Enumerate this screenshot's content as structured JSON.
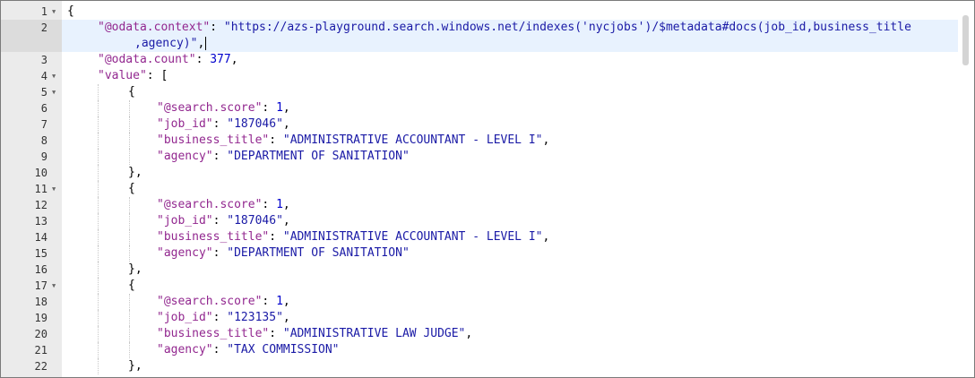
{
  "gutter": {
    "lines": [
      {
        "n": "1",
        "fold": true
      },
      {
        "n": "2",
        "fold": false,
        "active": true
      },
      {
        "n": "3",
        "fold": false
      },
      {
        "n": "4",
        "fold": true
      },
      {
        "n": "5",
        "fold": true
      },
      {
        "n": "6",
        "fold": false
      },
      {
        "n": "7",
        "fold": false
      },
      {
        "n": "8",
        "fold": false
      },
      {
        "n": "9",
        "fold": false
      },
      {
        "n": "10",
        "fold": false
      },
      {
        "n": "11",
        "fold": true
      },
      {
        "n": "12",
        "fold": false
      },
      {
        "n": "13",
        "fold": false
      },
      {
        "n": "14",
        "fold": false
      },
      {
        "n": "15",
        "fold": false
      },
      {
        "n": "16",
        "fold": false
      },
      {
        "n": "17",
        "fold": true
      },
      {
        "n": "18",
        "fold": false
      },
      {
        "n": "19",
        "fold": false
      },
      {
        "n": "20",
        "fold": false
      },
      {
        "n": "21",
        "fold": false
      },
      {
        "n": "22",
        "fold": false
      }
    ],
    "fold_icon": "triangle-down-icon"
  },
  "code": {
    "rows": [
      {
        "lvl": 0,
        "t": [
          [
            "p",
            "{"
          ]
        ]
      },
      {
        "lvl": 1,
        "active": true,
        "t": [
          [
            "k",
            "\"@odata.context\""
          ],
          [
            "p",
            ": "
          ],
          [
            "s",
            "\"https://azs-playground.search.windows.net/indexes('nycjobs')/$metadata#docs(job_id,business_title"
          ]
        ]
      },
      {
        "lvl": 1,
        "wrap": true,
        "active": true,
        "cursor": true,
        "t": [
          [
            "s",
            ",agency)\""
          ],
          [
            "p",
            ","
          ]
        ]
      },
      {
        "lvl": 1,
        "t": [
          [
            "k",
            "\"@odata.count\""
          ],
          [
            "p",
            ": "
          ],
          [
            "n",
            "377"
          ],
          [
            "p",
            ","
          ]
        ]
      },
      {
        "lvl": 1,
        "t": [
          [
            "k",
            "\"value\""
          ],
          [
            "p",
            ": ["
          ]
        ]
      },
      {
        "lvl": 2,
        "t": [
          [
            "p",
            "{"
          ]
        ]
      },
      {
        "lvl": 3,
        "t": [
          [
            "k",
            "\"@search.score\""
          ],
          [
            "p",
            ": "
          ],
          [
            "n",
            "1"
          ],
          [
            "p",
            ","
          ]
        ]
      },
      {
        "lvl": 3,
        "t": [
          [
            "k",
            "\"job_id\""
          ],
          [
            "p",
            ": "
          ],
          [
            "s",
            "\"187046\""
          ],
          [
            "p",
            ","
          ]
        ]
      },
      {
        "lvl": 3,
        "t": [
          [
            "k",
            "\"business_title\""
          ],
          [
            "p",
            ": "
          ],
          [
            "s",
            "\"ADMINISTRATIVE ACCOUNTANT - LEVEL I\""
          ],
          [
            "p",
            ","
          ]
        ]
      },
      {
        "lvl": 3,
        "t": [
          [
            "k",
            "\"agency\""
          ],
          [
            "p",
            ": "
          ],
          [
            "s",
            "\"DEPARTMENT OF SANITATION\""
          ]
        ]
      },
      {
        "lvl": 2,
        "t": [
          [
            "p",
            "},"
          ]
        ]
      },
      {
        "lvl": 2,
        "t": [
          [
            "p",
            "{"
          ]
        ]
      },
      {
        "lvl": 3,
        "t": [
          [
            "k",
            "\"@search.score\""
          ],
          [
            "p",
            ": "
          ],
          [
            "n",
            "1"
          ],
          [
            "p",
            ","
          ]
        ]
      },
      {
        "lvl": 3,
        "t": [
          [
            "k",
            "\"job_id\""
          ],
          [
            "p",
            ": "
          ],
          [
            "s",
            "\"187046\""
          ],
          [
            "p",
            ","
          ]
        ]
      },
      {
        "lvl": 3,
        "t": [
          [
            "k",
            "\"business_title\""
          ],
          [
            "p",
            ": "
          ],
          [
            "s",
            "\"ADMINISTRATIVE ACCOUNTANT - LEVEL I\""
          ],
          [
            "p",
            ","
          ]
        ]
      },
      {
        "lvl": 3,
        "t": [
          [
            "k",
            "\"agency\""
          ],
          [
            "p",
            ": "
          ],
          [
            "s",
            "\"DEPARTMENT OF SANITATION\""
          ]
        ]
      },
      {
        "lvl": 2,
        "t": [
          [
            "p",
            "},"
          ]
        ]
      },
      {
        "lvl": 2,
        "t": [
          [
            "p",
            "{"
          ]
        ]
      },
      {
        "lvl": 3,
        "t": [
          [
            "k",
            "\"@search.score\""
          ],
          [
            "p",
            ": "
          ],
          [
            "n",
            "1"
          ],
          [
            "p",
            ","
          ]
        ]
      },
      {
        "lvl": 3,
        "t": [
          [
            "k",
            "\"job_id\""
          ],
          [
            "p",
            ": "
          ],
          [
            "s",
            "\"123135\""
          ],
          [
            "p",
            ","
          ]
        ]
      },
      {
        "lvl": 3,
        "t": [
          [
            "k",
            "\"business_title\""
          ],
          [
            "p",
            ": "
          ],
          [
            "s",
            "\"ADMINISTRATIVE LAW JUDGE\""
          ],
          [
            "p",
            ","
          ]
        ]
      },
      {
        "lvl": 3,
        "t": [
          [
            "k",
            "\"agency\""
          ],
          [
            "p",
            ": "
          ],
          [
            "s",
            "\"TAX COMMISSION\""
          ]
        ]
      },
      {
        "lvl": 2,
        "t": [
          [
            "p",
            "},"
          ]
        ]
      }
    ]
  },
  "colors": {
    "key": "#92278f",
    "string": "#1a1aa6",
    "number": "#0000cd",
    "gutter_bg": "#ebebeb",
    "active_line": "#e8f2fe"
  }
}
